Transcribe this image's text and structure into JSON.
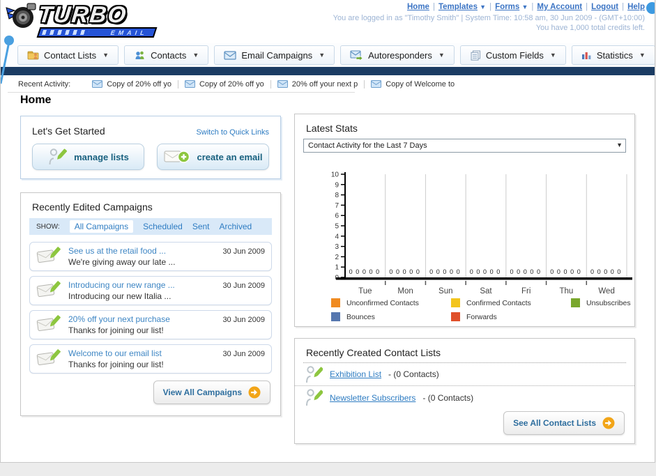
{
  "header": {
    "separator": "|",
    "links": [
      {
        "label": "Home"
      },
      {
        "label": "Templates",
        "dropdown": true
      },
      {
        "label": "Forms",
        "dropdown": true
      },
      {
        "label": "My Account"
      },
      {
        "label": "Logout"
      },
      {
        "label": "Help"
      }
    ],
    "status_line1": "You are logged in as \"Timothy Smith\" | System Time: 10:58 am, 30 Jun 2009 - (GMT+10:00)",
    "status_line2": "You have 1,000 total credits left.",
    "logo_title": "TURBO",
    "logo_subtitle": "EMAIL"
  },
  "nav": {
    "items": [
      {
        "label": "Contact Lists",
        "icon": "folder-user-icon"
      },
      {
        "label": "Contacts",
        "icon": "users-icon"
      },
      {
        "label": "Email Campaigns",
        "icon": "envelope-icon"
      },
      {
        "label": "Autoresponders",
        "icon": "envelope-arrow-icon"
      },
      {
        "label": "Custom Fields",
        "icon": "fields-icon"
      },
      {
        "label": "Statistics",
        "icon": "bar-chart-icon"
      }
    ]
  },
  "recent_activity": {
    "label": "Recent Activity:",
    "items": [
      "Copy of 20% off yo",
      "Copy of 20% off yo",
      "20% off your next p",
      "Copy of Welcome to"
    ]
  },
  "page": {
    "title": "Home"
  },
  "get_started": {
    "title": "Let's Get Started",
    "switch_link": "Switch to Quick Links",
    "manage_lists_label": "manage lists",
    "create_email_label": "create an email"
  },
  "campaigns": {
    "title": "Recently Edited Campaigns",
    "show_label": "SHOW:",
    "filters": [
      "All Campaigns",
      "Scheduled",
      "Sent",
      "Archived"
    ],
    "active_filter": "All Campaigns",
    "rows": [
      {
        "title": "See us at the retail food ...",
        "subtitle": "We're giving away our late ...",
        "date": "30 Jun 2009"
      },
      {
        "title": "Introducing our new range ...",
        "subtitle": "Introducing our new Italia ...",
        "date": "30 Jun 2009"
      },
      {
        "title": "20% off your next purchase",
        "subtitle": "Thanks for joining our list!",
        "date": "30 Jun 2009"
      },
      {
        "title": "Welcome to our email list",
        "subtitle": "Thanks for joining our list!",
        "date": "30 Jun 2009"
      }
    ],
    "view_all_label": "View All Campaigns"
  },
  "latest_stats": {
    "title": "Latest Stats",
    "dropdown_value": "Contact Activity for the Last 7 Days"
  },
  "chart_data": {
    "type": "bar",
    "title": "Contact Activity for the Last 7 Days",
    "categories": [
      "Tue",
      "Mon",
      "Sun",
      "Sat",
      "Fri",
      "Thu",
      "Wed"
    ],
    "series": [
      {
        "name": "Unconfirmed Contacts",
        "color": "#f08b22",
        "values": [
          0,
          0,
          0,
          0,
          0,
          0,
          0
        ]
      },
      {
        "name": "Confirmed Contacts",
        "color": "#f3c51d",
        "values": [
          0,
          0,
          0,
          0,
          0,
          0,
          0
        ]
      },
      {
        "name": "Unsubscribes",
        "color": "#79a72c",
        "values": [
          0,
          0,
          0,
          0,
          0,
          0,
          0
        ]
      },
      {
        "name": "Bounces",
        "color": "#5677af",
        "values": [
          0,
          0,
          0,
          0,
          0,
          0,
          0
        ]
      },
      {
        "name": "Forwards",
        "color": "#e0502a",
        "values": [
          0,
          0,
          0,
          0,
          0,
          0,
          0
        ]
      }
    ],
    "ylim": [
      0,
      10
    ],
    "yticks": [
      0,
      1,
      2,
      3,
      4,
      5,
      6,
      7,
      8,
      9,
      10
    ],
    "grid": true,
    "legend_position": "bottom"
  },
  "contact_lists": {
    "title": "Recently Created Contact Lists",
    "items": [
      {
        "name": "Exhibition List",
        "detail": "- (0 Contacts)"
      },
      {
        "name": "Newsletter Subscribers",
        "detail": "- (0 Contacts)"
      }
    ],
    "see_all_label": "See All Contact Lists"
  },
  "colors": {
    "accent_orange": "#f2a518",
    "link_blue": "#2e7cc2",
    "nav_bar_dark": "#1b3c63"
  }
}
